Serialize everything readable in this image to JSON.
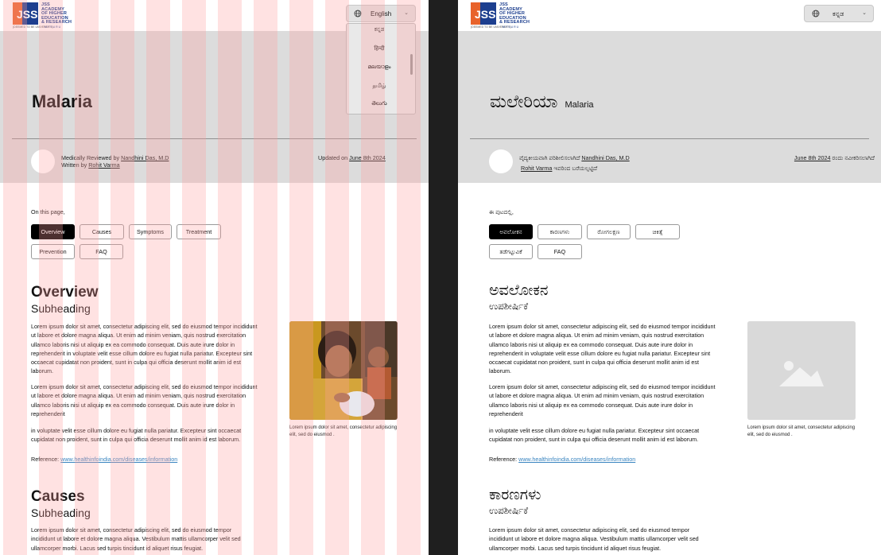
{
  "logo": {
    "initials": "JSS",
    "name_lines": "JSS\nACADEMY\nOF HIGHER\nEDUCATION\n& RESEARCH",
    "deemed": "(DEEMED TO BE UNIVERSITY)",
    "city": "MYSURU"
  },
  "colors": {
    "brand_blue": "#1d3f8f",
    "brand_orange": "#e8632b",
    "hero_bg": "#dcdcdc",
    "link": "#3a85c0",
    "divider": "#1f1f1f",
    "grid_overlay": "#ffa0a0"
  },
  "icons": {
    "language": "globe-icon",
    "dropdown": "chevron-down-icon",
    "placeholder": "image-placeholder-icon"
  },
  "left": {
    "language": {
      "selected": "English",
      "options": [
        "ಕನ್ನಡ",
        "हिन्दी",
        "മലയാളം",
        "தமிழ்",
        "తెలుగు"
      ]
    },
    "title": "Malaria",
    "reviewed_prefix": "Medically Reviewed by",
    "reviewer": "Nandhini Das, M.D",
    "written_prefix": "Written by",
    "writer": "Rohit Varma",
    "updated_prefix": "Updated on",
    "updated_date": "June 8th 2024",
    "on_this_page": "On this page,",
    "tabs": [
      "Overview",
      "Causes",
      "Symptoms",
      "Treatment",
      "Prevention",
      "FAQ"
    ],
    "overview_title": "Overview",
    "overview_sub": "Subheading",
    "p1": "Lorem ipsum dolor sit amet, consectetur adipiscing elit, sed do eiusmod tempor incididunt ut labore et dolore magna aliqua. Ut enim ad minim veniam, quis nostrud exercitation ullamco laboris nisi ut aliquip ex ea commodo consequat. Duis aute irure dolor in reprehenderit in voluptate velit esse cillum dolore eu fugiat nulla pariatur. Excepteur sint occaecat cupidatat non proident, sunt in culpa qui officia deserunt mollit anim id est laborum.",
    "p2": "Lorem ipsum dolor sit amet, consectetur adipiscing elit, sed do eiusmod tempor incididunt ut labore et dolore magna aliqua. Ut enim ad minim veniam, quis nostrud exercitation ullamco laboris nisi ut aliquip ex ea commodo consequat. Duis aute irure dolor in reprehenderit",
    "p3": " in voluptate velit esse cillum dolore eu fugiat nulla pariatur. Excepteur sint occaecat cupidatat non proident, sunt in culpa qui officia deserunt mollit anim id est laborum.",
    "reference_label": "Reference:",
    "reference_url": "www.healthinfoindia.com/diseases/information",
    "caption": "Lorem ipsum dolor sit amet, consectetur adipiscing elit, sed do eiusmod .",
    "causes_title": "Causes",
    "causes_sub": "Subheading",
    "p4": "Lorem ipsum dolor sit amet, consectetur adipiscing elit, sed do eiusmod tempor incididunt ut labore et dolore magna aliqua. Vestibulum mattis ullamcorper velit sed ullamcorper morbi. Lacus sed turpis tincidunt id aliquet risus feugiat."
  },
  "right": {
    "language": {
      "selected": "ಕನ್ನಡ"
    },
    "title": "ಮಲೇರಿಯಾ",
    "title_en": "Malaria",
    "reviewed_prefix": "ವೈದ್ಯಕೀಯವಾಗಿ ಪರಿಶೀಲಿಸಲಾಗಿದೆ",
    "reviewer": "Nandhini Das, M.D",
    "writer": "Rohit Varma",
    "written_suffix": "ಇವರಿಂದ ಬರೆಯಲ್ಪಟ್ಟಿದೆ",
    "updated_date": "June 8th 2024",
    "updated_suffix": "ರಂದು ನವೀಕರಿಸಲಾಗಿದೆ",
    "on_this_page": "ಈ ಪುಟದಲ್ಲಿ,",
    "tabs": [
      "ಅವಲೋಕನ",
      "ಕಾರಣಗಳು",
      "ರೋಗಲಕ್ಷಣ",
      "ಚಿಕಿತ್ಸೆ",
      "ತಡೆಗಟ್ಟುವಿಕೆ",
      "FAQ"
    ],
    "overview_title": "ಅವಲೋಕನ",
    "overview_sub": "ಉಪಶೀರ್ಷಿಕೆ",
    "p1": "Lorem ipsum dolor sit amet, consectetur adipiscing elit, sed do eiusmod tempor incididunt ut labore et dolore magna aliqua. Ut enim ad minim veniam, quis nostrud exercitation ullamco laboris nisi ut aliquip ex ea commodo consequat. Duis aute irure dolor in reprehenderit in voluptate velit esse cillum dolore eu fugiat nulla pariatur. Excepteur sint occaecat cupidatat non proident, sunt in culpa qui officia deserunt mollit anim id est laborum.",
    "p2": "Lorem ipsum dolor sit amet, consectetur adipiscing elit, sed do eiusmod tempor incididunt ut labore et dolore magna aliqua. Ut enim ad minim veniam, quis nostrud exercitation ullamco laboris nisi ut aliquip ex ea commodo consequat. Duis aute irure dolor in reprehenderit",
    "p3": " in voluptate velit esse cillum dolore eu fugiat nulla pariatur. Excepteur sint occaecat cupidatat non proident, sunt in culpa qui officia deserunt mollit anim id est laborum.",
    "reference_label": "Reference:",
    "reference_url": "www.healthinfoindia.com/diseases/information",
    "caption": "Lorem ipsum dolor sit amet, consectetur adipiscing elit, sed do eiusmod .",
    "causes_title": "ಕಾರಣಗಳು",
    "causes_sub": "ಉಪಶೀರ್ಷಿಕೆ",
    "p4": "Lorem ipsum dolor sit amet, consectetur adipiscing elit, sed do eiusmod tempor incididunt ut labore et dolore magna aliqua. Vestibulum mattis ullamcorper velit sed ullamcorper morbi. Lacus sed turpis tincidunt id aliquet risus feugiat."
  }
}
